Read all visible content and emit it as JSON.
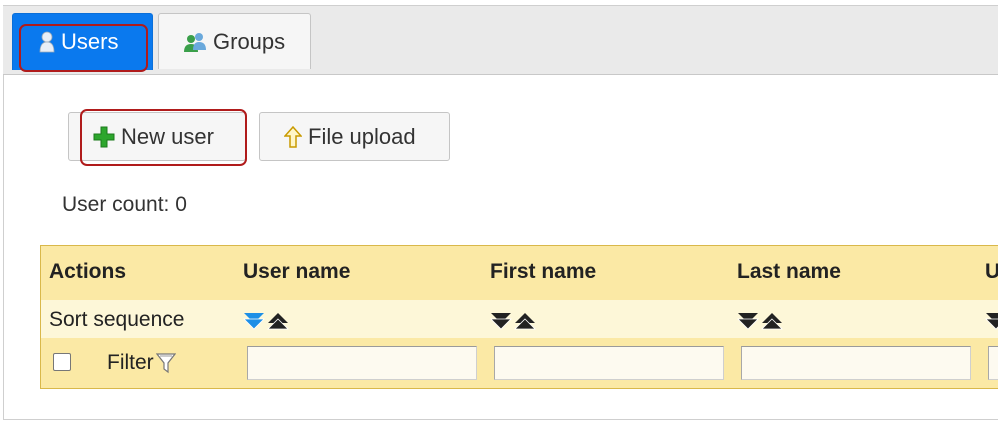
{
  "tabs": [
    {
      "label": "Users",
      "icon": "user-icon",
      "active": true
    },
    {
      "label": "Groups",
      "icon": "group-icon",
      "active": false
    }
  ],
  "toolbar": {
    "new_user_label": "New user",
    "new_user_icon": "plus-icon",
    "file_upload_label": "File upload",
    "file_upload_icon": "arrow-up-icon"
  },
  "user_count": "User count: 0",
  "grid": {
    "columns": [
      "Actions",
      "User name",
      "First name",
      "Last name",
      "U"
    ],
    "sort_label": "Sort sequence",
    "filter_label": "Filter",
    "filter_icon": "funnel-icon",
    "colors": {
      "header_bg": "#fbe9a5",
      "sort_bg": "#fdf7d8",
      "border": "#d9b84a",
      "active_sort": "#1e8fe6"
    }
  },
  "colors": {
    "active_tab": "#0a79ee",
    "highlight": "#b01b1b"
  }
}
